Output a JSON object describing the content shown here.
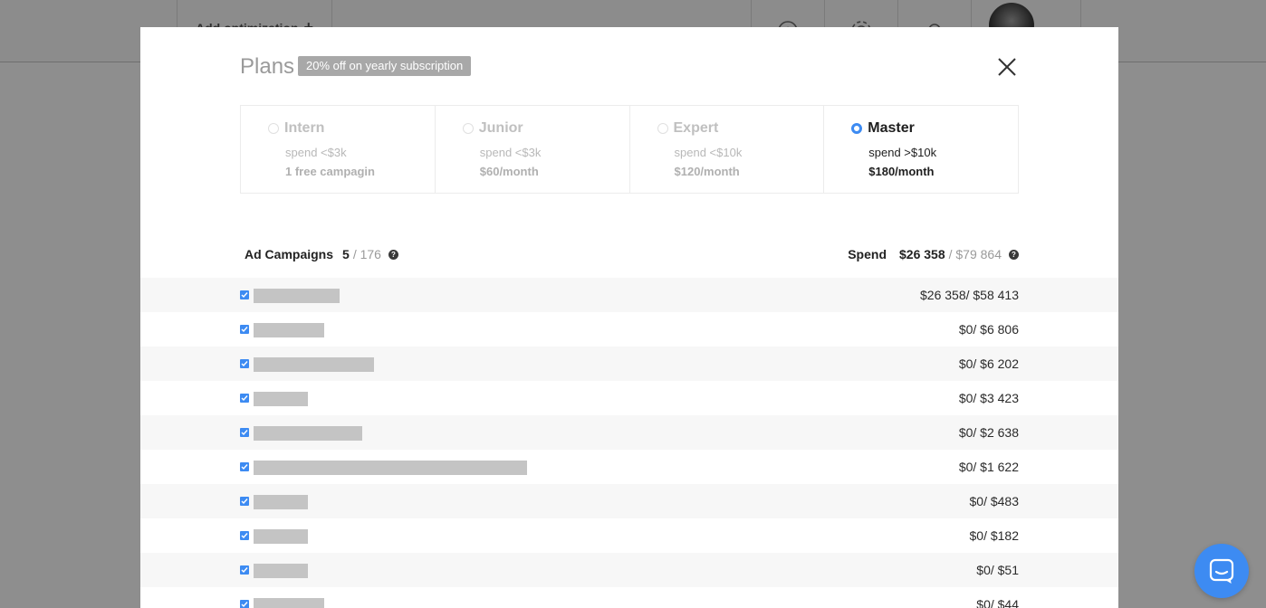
{
  "background": {
    "add_optimization_label": "Add optimization",
    "add_optimization_icon": "plus-icon"
  },
  "modal": {
    "title": "Plans",
    "discount_badge": "20% off on yearly subscription",
    "close_icon": "close-icon"
  },
  "plans": [
    {
      "name": "Intern",
      "spend": "spend <$3k",
      "price": "1 free campagin",
      "selected": false
    },
    {
      "name": "Junior",
      "spend": "spend <$3k",
      "price": "$60/month",
      "selected": false
    },
    {
      "name": "Expert",
      "spend": "spend <$10k",
      "price": "$120/month",
      "selected": false
    },
    {
      "name": "Master",
      "spend": "spend >$10k",
      "price": "$180/month",
      "selected": true
    }
  ],
  "summary": {
    "campaigns_label": "Ad Campaigns",
    "campaigns_selected": "5",
    "campaigns_total": "/ 176",
    "spend_label": "Spend",
    "spend_selected": "$26 358",
    "spend_total": "/ $79 864",
    "help_icon": "?"
  },
  "campaigns": [
    {
      "checked": true,
      "spend": "$26 358/ $58 413"
    },
    {
      "checked": true,
      "spend": "$0/ $6 806"
    },
    {
      "checked": true,
      "spend": "$0/ $6 202"
    },
    {
      "checked": true,
      "spend": "$0/ $3 423"
    },
    {
      "checked": true,
      "spend": "$0/ $2 638"
    },
    {
      "checked": true,
      "spend": "$0/ $1 622"
    },
    {
      "checked": true,
      "spend": "$0/ $483"
    },
    {
      "checked": true,
      "spend": "$0/ $182"
    },
    {
      "checked": true,
      "spend": "$0/ $51"
    },
    {
      "checked": true,
      "spend": "$0/ $44"
    }
  ],
  "colors": {
    "accent": "#3d8bf2",
    "overlay": "#8e8e8e",
    "placeholder": "#c4c4c4"
  },
  "chat_widget_icon": "chat-bubble-icon"
}
